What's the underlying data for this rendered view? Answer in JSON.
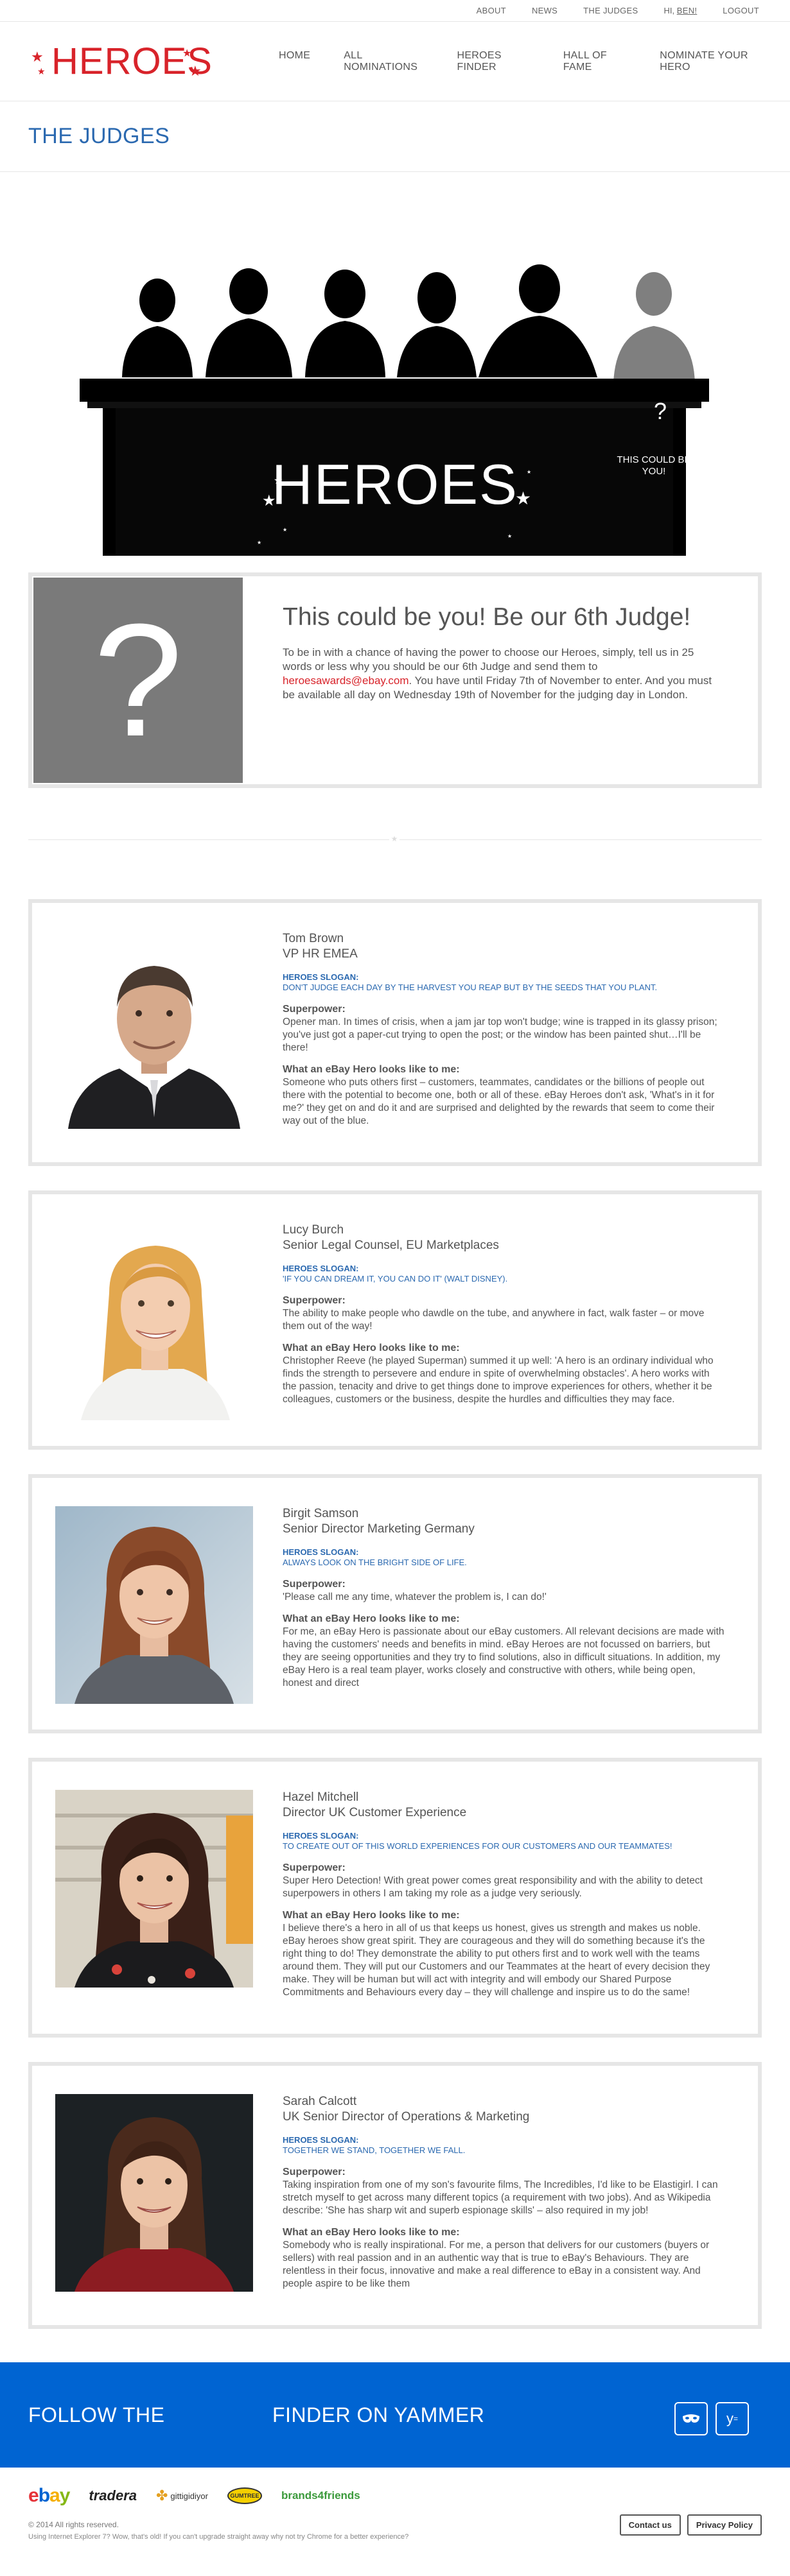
{
  "topbar": {
    "links": [
      "ABOUT",
      "NEWS",
      "THE JUDGES"
    ],
    "greeting": "HI,",
    "user": "BEN!",
    "logout": "LOGOUT"
  },
  "header": {
    "logo": "HEROES",
    "nav": [
      "HOME",
      "ALL NOMINATIONS",
      "HEROES FINDER",
      "HALL OF FAME",
      "NOMINATE YOUR HERO"
    ]
  },
  "page_title": "THE JUDGES",
  "banner": {
    "logo": "HEROES",
    "question": "?",
    "cta": "THIS COULD BE YOU!"
  },
  "invite": {
    "image_glyph": "?",
    "title": "This could be you! Be our 6th Judge!",
    "text_before": "To be in with a chance of having the power to choose our Heroes, simply, tell us in 25 words or less why you should be our 6th Judge and send them to ",
    "email": "heroesawards@ebay.com",
    "text_after": ". You have until Friday 7th of November to enter. And you must be available all day on Wednesday 19th of November for the judging day in London."
  },
  "labels": {
    "slogan": "HEROES SLOGAN:",
    "superpower": "Superpower:",
    "hero": "What an eBay Hero looks like to me:"
  },
  "judges": [
    {
      "name": "Tom Brown",
      "role": "VP HR EMEA",
      "slogan": "DON'T JUDGE EACH DAY BY THE HARVEST YOU REAP BUT BY THE SEEDS THAT YOU PLANT.",
      "superpower": "Opener man. In times of crisis, when a jam jar top won't budge; wine is trapped in its glassy prison; you've just got a paper-cut trying to open the post; or the window has been painted shut…I'll be there!",
      "hero": "Someone who puts others first – customers, teammates, candidates or the billions of people out there with the potential to become one, both or all of these. eBay Heroes don't ask, 'What's in it for me?' they get on and do it and are surprised and delighted by the rewards that seem to come their way out of the blue."
    },
    {
      "name": "Lucy Burch",
      "role": "Senior Legal Counsel, EU Marketplaces",
      "slogan": "'IF YOU CAN DREAM IT, YOU CAN DO IT' (WALT DISNEY).",
      "superpower": "The ability to make people who dawdle on the tube, and anywhere in fact, walk faster – or move them out of the way!",
      "hero": "Christopher Reeve (he played Superman) summed it up well: 'A hero is an ordinary individual who finds the strength to persevere and endure in spite of overwhelming obstacles'. A hero works with the passion, tenacity and drive to get things done to improve experiences for others, whether it be colleagues, customers or the business, despite the hurdles and difficulties they may face."
    },
    {
      "name": "Birgit Samson",
      "role": "Senior Director Marketing Germany",
      "slogan": "ALWAYS LOOK ON THE BRIGHT SIDE OF LIFE.",
      "superpower": "'Please call me any time, whatever the problem is, I can do!'",
      "hero": "For me, an eBay Hero is passionate about our eBay customers. All relevant decisions are made with having the customers' needs and benefits in mind. eBay Heroes are not focussed on barriers, but they are seeing opportunities and they try to find solutions, also in difficult situations. In addition, my eBay Hero is a real team player, works closely and constructive with others, while being open, honest and direct"
    },
    {
      "name": "Hazel Mitchell",
      "role": "Director UK Customer Experience",
      "slogan": "TO CREATE OUT OF THIS WORLD EXPERIENCES FOR OUR CUSTOMERS AND OUR TEAMMATES!",
      "superpower": "Super Hero Detection! With great power comes great responsibility and with the ability to detect superpowers in others I am taking my role as a judge very seriously.",
      "hero": "I believe there's a hero in all of us that keeps us honest, gives us strength and makes us noble. eBay heroes show great spirit. They are courageous and they will do something because it's the right thing to do! They demonstrate the ability to put others first and to work well with the teams around them. They will put our Customers and our Teammates at the heart of every decision they make. They will be human but will act with integrity and will embody our Shared Purpose Commitments and Behaviours every day – they will challenge and inspire us to do the same!"
    },
    {
      "name": "Sarah Calcott",
      "role": "UK Senior Director of Operations & Marketing",
      "slogan": "TOGETHER WE STAND, TOGETHER WE FALL.",
      "superpower": "Taking inspiration from one of my son's favourite films, The Incredibles, I'd like to be Elastigirl. I can stretch myself to get across many different topics (a requirement with two jobs). And as Wikipedia describe: 'She has sharp wit and superb espionage skills' – also required in my job!",
      "hero": "Somebody who is really inspirational. For me, a person that delivers for our customers (buyers or sellers) with real passion and in an authentic way that is true to eBay's Behaviours. They are relentless in their focus, innovative and make a real difference to eBay in a consistent way. And people aspire to be like them"
    }
  ],
  "follow": {
    "part1": "FOLLOW THE",
    "part2": "FINDER ON YAMMER",
    "icons": [
      "mask-icon",
      "yammer-icon"
    ]
  },
  "footer": {
    "brands": {
      "ebay": [
        "e",
        "b",
        "a",
        "y"
      ],
      "tradera": "tradera",
      "gittigidiyor": "gittigidiyor",
      "gumtree": "GUMTREE",
      "brands4friends": "brands4friends"
    },
    "copyright": "© 2014 All rights reserved.",
    "ie_note": "Using Internet Explorer 7? Wow, that's old! If you can't upgrade straight away why not try Chrome for a better experience?",
    "buttons": [
      "Contact us",
      "Privacy Policy"
    ]
  },
  "colors": {
    "brand_red": "#d8232a",
    "title_blue": "#2b69b0",
    "footer_blue": "#0064d2"
  }
}
